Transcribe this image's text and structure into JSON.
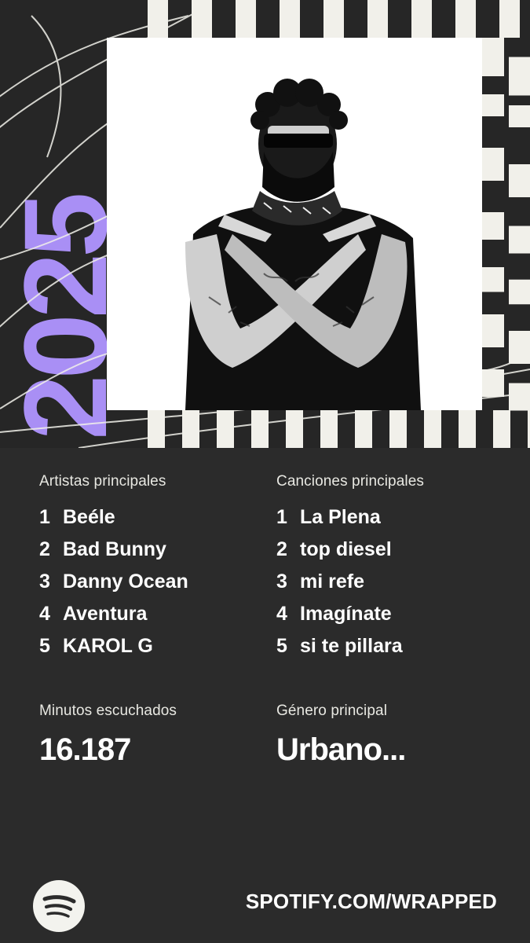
{
  "brand": {
    "year": "2025",
    "accent": "#a98ff5",
    "stripe_dark": "#262626",
    "stripe_light": "#f1f0ea",
    "logo_icon": "spotify-logo-icon"
  },
  "cover_image": {
    "icon": "artist-photo"
  },
  "top_artists": {
    "label": "Artistas principales",
    "items": [
      {
        "rank": "1",
        "name": "Beéle"
      },
      {
        "rank": "2",
        "name": "Bad Bunny"
      },
      {
        "rank": "3",
        "name": "Danny Ocean"
      },
      {
        "rank": "4",
        "name": "Aventura"
      },
      {
        "rank": "5",
        "name": "KAROL G"
      }
    ]
  },
  "top_songs": {
    "label": "Canciones principales",
    "items": [
      {
        "rank": "1",
        "name": "La Plena"
      },
      {
        "rank": "2",
        "name": "top diesel"
      },
      {
        "rank": "3",
        "name": "mi refe"
      },
      {
        "rank": "4",
        "name": "Imagínate"
      },
      {
        "rank": "5",
        "name": "si te pillara"
      }
    ]
  },
  "minutes": {
    "label": "Minutos escuchados",
    "value": "16.187"
  },
  "genre": {
    "label": "Género principal",
    "value": "Urbano..."
  },
  "footer": {
    "url": "SPOTIFY.COM/WRAPPED"
  }
}
